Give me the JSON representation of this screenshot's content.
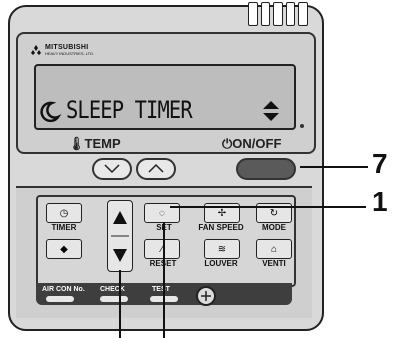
{
  "brand": {
    "name": "MITSUBISHI",
    "subtitle": "HEAVY INDUSTRIES, LTD."
  },
  "display": {
    "text": "SLEEP TIMER"
  },
  "labels": {
    "temp": "TEMP",
    "onoff": "ON/OFF"
  },
  "keys": {
    "timer": "TIMER",
    "set": "SET",
    "fan_speed": "FAN SPEED",
    "mode": "MODE",
    "reset": "RESET",
    "louver": "LOUVER",
    "venti": "VENTI",
    "air_con_no": "AIR CON No.",
    "check": "CHECK",
    "test": "TEST"
  },
  "callouts": {
    "seven": "7",
    "one": "1"
  }
}
